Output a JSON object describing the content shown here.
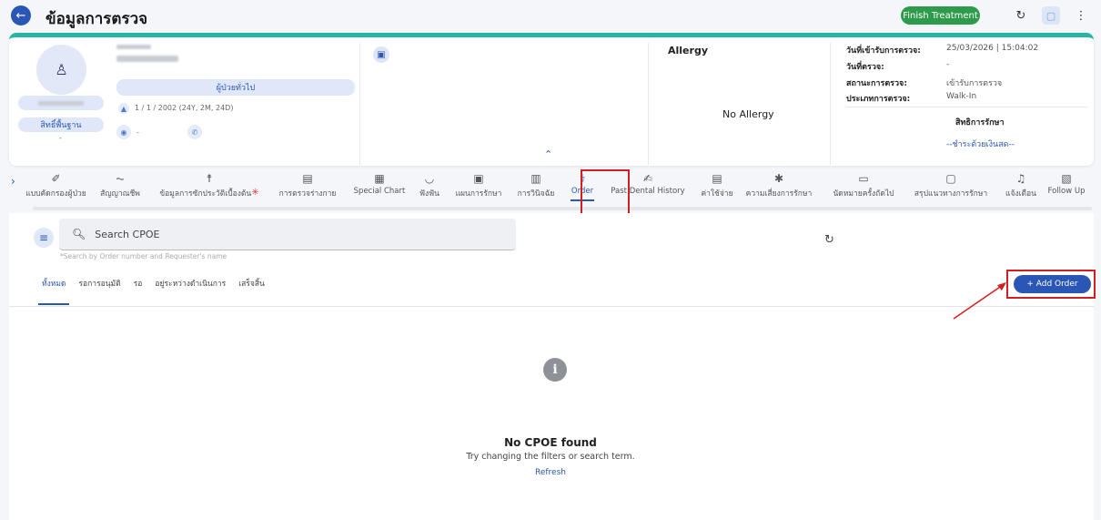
{
  "header": {
    "back_icon": "arrow-left-icon",
    "title": "ข้อมูลการตรวจ",
    "finish_label": "Finish Treatment",
    "refresh_icon": "refresh-icon",
    "square_icon": "square-icon",
    "more_icon": "more-vertical-icon"
  },
  "patient": {
    "type_label": "ผู้ป่วยทั่วไป",
    "birth_info": "1 / 1 / 2002 (24Y, 2M, 24D)",
    "rights_label": "สิทธิ์พื้นฐาน",
    "rights_value": "-",
    "extra_value": "-"
  },
  "allergy": {
    "title": "Allergy",
    "empty": "No Allergy"
  },
  "visit_info": {
    "rows": [
      {
        "label": "วันที่เข้ารับการตรวจ:",
        "value": "25/03/2026 | 15:04:02"
      },
      {
        "label": "วันที่ตรวจ:",
        "value": "-"
      },
      {
        "label": "สถานะการตรวจ:",
        "value": "เข้ารับการตรวจ"
      },
      {
        "label": "ประเภทการตรวจ:",
        "value": "Walk-In"
      }
    ],
    "rights_title": "สิทธิการรักษา",
    "rights_value": "--ชำระด้วยเงินสด--"
  },
  "tabs": [
    {
      "label": "แบบคัดกรองผู้ป่วย",
      "icon": "✐"
    },
    {
      "label": "สัญญาณชีพ",
      "icon": "⏦"
    },
    {
      "label": "ข้อมูลการซักประวัติเบื้องต้น",
      "icon": "☨"
    },
    {
      "label": "การตรวจร่างกาย",
      "icon": "▤"
    },
    {
      "label": "Special Chart",
      "icon": "▦"
    },
    {
      "label": "ฟังฟัน",
      "icon": "◡"
    },
    {
      "label": "แผนการรักษา",
      "icon": "▣"
    },
    {
      "label": "การวินิจฉัย",
      "icon": "▥"
    },
    {
      "label": "Order",
      "icon": "⚕"
    },
    {
      "label": "Past Dental History",
      "icon": "✍"
    },
    {
      "label": "ค่าใช้จ่าย",
      "icon": "▤"
    },
    {
      "label": "ความเสี่ยงการรักษา",
      "icon": "✱"
    },
    {
      "label": "นัดหมายครั้งถัดไป",
      "icon": "▭"
    },
    {
      "label": "สรุปแนวทางการรักษา",
      "icon": "▢"
    },
    {
      "label": "แจ้งเตือน",
      "icon": "♫"
    },
    {
      "label": "Follow Up",
      "icon": "▧"
    }
  ],
  "search": {
    "placeholder": "Search CPOE",
    "hint": "*Search by Order number and Requester's name"
  },
  "status_tabs": [
    "ทั้งหมด",
    "รอการอนุมัติ",
    "รอ",
    "อยู่ระหว่างดำเนินการ",
    "เสร็จสิ้น"
  ],
  "add_order_label": "+ Add Order",
  "empty_state": {
    "icon": "info-icon",
    "title": "No CPOE found",
    "subtitle": "Try changing the filters or search term.",
    "refresh": "Refresh"
  },
  "colors": {
    "primary": "#2a56b5",
    "finish": "#2e9a4b",
    "accent_teal": "#26b5a5",
    "highlight_red": "#d21f1f"
  }
}
